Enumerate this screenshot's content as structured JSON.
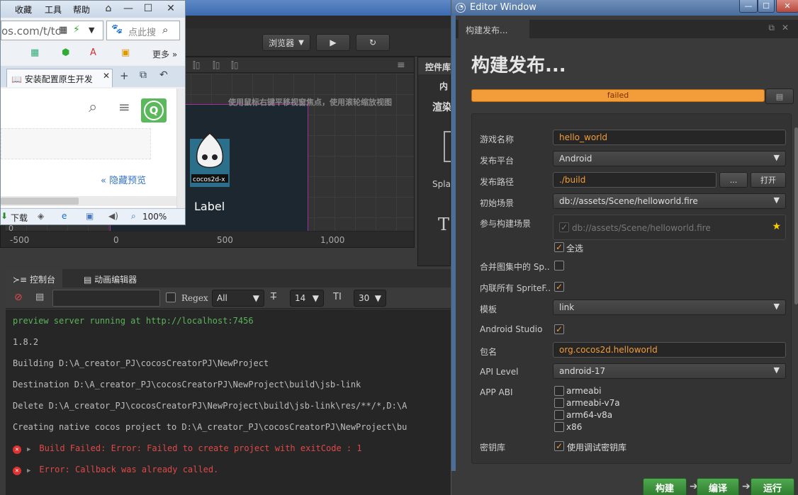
{
  "browser": {
    "menu": [
      "收藏",
      "工具",
      "帮助"
    ],
    "address": "os.com/t/tc",
    "search_placeholder": "点此搜",
    "more_label": "更多",
    "tab_label": "安装配置原生开发",
    "hide_preview": "« 隐藏预览",
    "avatar_letter": "Q",
    "status_download": "下载",
    "zoom": "100%"
  },
  "editor": {
    "browser_select": "浏览器",
    "scene_hint": "使用鼠标右键平移视窗焦点，使用滚轮缩放视图",
    "label_node": "Label",
    "ruler": [
      "-500",
      "0",
      "500",
      "1,000"
    ],
    "ruler_zero": "0",
    "library_title": "控件库",
    "library_sub": "内",
    "library_text1": "渲染",
    "library_text2": "Spla",
    "library_text3": "T",
    "console_tab": "控制台",
    "anim_tab": "动画编辑器",
    "regex_label": "Regex",
    "level_select": "All",
    "font_size": "14",
    "line_height": "30",
    "logs": [
      {
        "text": "preview server running at http://localhost:7456",
        "kind": "green"
      },
      {
        "text": "1.8.2",
        "kind": "normal"
      },
      {
        "text": "Building D:\\A_creator_PJ\\cocosCreatorPJ\\NewProject",
        "kind": "normal"
      },
      {
        "text": "Destination D:\\A_creator_PJ\\cocosCreatorPJ\\NewProject\\build\\jsb-link",
        "kind": "normal"
      },
      {
        "text": "Delete D:\\A_creator_PJ\\cocosCreatorPJ\\NewProject\\build\\jsb-link\\res/**/*,D:\\A",
        "kind": "normal"
      },
      {
        "text": "Creating native cocos project to D:\\A_creator_PJ\\cocosCreatorPJ\\NewProject\\bu",
        "kind": "normal"
      },
      {
        "text": "Build Failed: Error: Failed to create project with exitCode : 1",
        "kind": "red"
      },
      {
        "text": "Error: Callback was already called.",
        "kind": "red"
      }
    ]
  },
  "editor_window": {
    "title": "Editor Window",
    "tab": "构建发布...",
    "heading": "构建发布...",
    "progress_status": "failed",
    "progress_value": 1.0,
    "fields": {
      "game_name_label": "游戏名称",
      "game_name": "hello_world",
      "platform_label": "发布平台",
      "platform": "Android",
      "path_label": "发布路径",
      "path": "./build",
      "path_browse": "...",
      "path_open": "打开",
      "start_scene_label": "初始场景",
      "start_scene": "db://assets/Scene/helloworld.fire",
      "scenes_label": "参与构建场景",
      "scene_item": "db://assets/Scene/helloworld.fire",
      "select_all": "全选",
      "merge_label": "合并图集中的 Sp..",
      "inline_label": "内联所有 SpriteF..",
      "template_label": "模板",
      "template": "link",
      "studio_label": "Android Studio",
      "package_label": "包名",
      "package": "org.cocos2d.helloworld",
      "api_label": "API Level",
      "api": "android-17",
      "abi_label": "APP ABI",
      "abi": [
        "armeabi",
        "armeabi-v7a",
        "arm64-v8a",
        "x86"
      ],
      "keystore_label": "密钥库",
      "keystore_option": "使用调试密钥库"
    },
    "buttons": {
      "build": "构建",
      "compile": "编译",
      "run": "运行"
    },
    "colors": {
      "accent": "#f39c3a",
      "green": "#3f953f"
    }
  }
}
